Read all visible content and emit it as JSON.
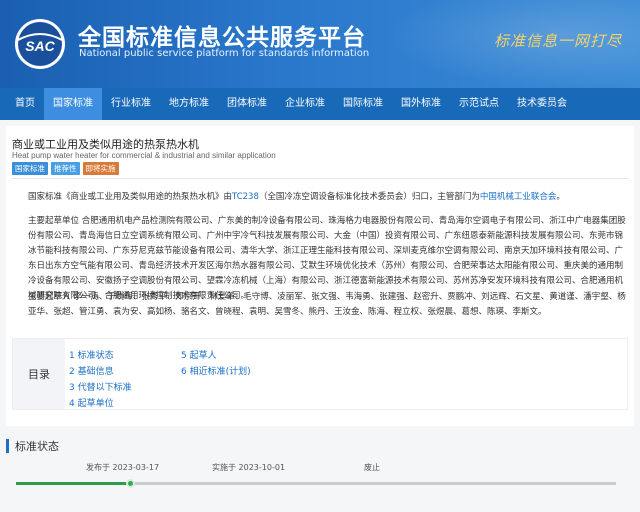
{
  "header": {
    "logo_text": "SAC",
    "title": "全国标准信息公共服务平台",
    "subtitle": "National public service platform  for standards information",
    "slogan": "标准信息一网打尽"
  },
  "nav": [
    {
      "label": "首页",
      "active": false
    },
    {
      "label": "国家标准",
      "active": true
    },
    {
      "label": "行业标准",
      "active": false
    },
    {
      "label": "地方标准",
      "active": false
    },
    {
      "label": "团体标准",
      "active": false
    },
    {
      "label": "企业标准",
      "active": false
    },
    {
      "label": "国际标准",
      "active": false
    },
    {
      "label": "国外标准",
      "active": false
    },
    {
      "label": "示范试点",
      "active": false
    },
    {
      "label": "技术委员会",
      "active": false
    }
  ],
  "standard": {
    "title": "商业或工业用及类似用途的热泵热水机",
    "title_en": "Heat pump water heater for commercial & industrial and similar application",
    "badges": [
      "国家标准",
      "推荐性",
      "即将实施"
    ],
    "org_prefix": "国家标准《商业或工业用及类似用途的热泵热水机》由",
    "tc_code": "TC238",
    "org_middle": "（全国冷冻空调设备标准化技术委员会）归口，主管部门为",
    "authority": "中国机械工业联合会",
    "org_suffix": "。",
    "drafting_units_label": "主要起草单位",
    "drafting_units": "合肥通用机电产品检测院有限公司、广东美的制冷设备有限公司、珠海格力电器股份有限公司、青岛海尔空调电子有限公司、浙江中广电器集团股份有限公司、青岛海信日立空调系统有限公司、广州中宇冷气科技发展有限公司、大金（中国）投资有限公司、广东纽恩泰新能源科技发展有限公司、东莞市锦冰节能科技有限公司、广东芬尼克兹节能设备有限公司、清华大学、浙江正理生能科技有限公司、深圳麦克维尔空调有限公司、南京天加环境科技有限公司、广东日出东方空气能有限公司、青岛经济技术开发区海尔热水器有限公司、艾默生环境优化技术（苏州）有限公司、合肥荣事达太阳能有限公司、重庆美的通用制冷设备有限公司、安徽扬子空调股份有限公司、望霖冷冻机械（上海）有限公司、浙江德富新能源技术有限公司、苏州苏净安发环境科技有限公司、合肥通用机械研究院有限公司、合肥通用环境控制技术有限责任公司。",
    "drafters_label": "主要起草人",
    "drafters": "李一涛、于晓晖、张秀平、郑宗开、林爱革、毛守博、凌丽军、张文强、韦海勇、张建强、赵密升、贾鹏冲、刘远辉、石文星、黄道谨、潘宇壑、杨亚华、张超、管江勇、袁为安、高如杨、骆名文、曾晓程、袁明、吴雪冬、熊丹、王汝金、陈海、程立权、张煜晨、葛想、陈瑛、李斯文。"
  },
  "toc": {
    "label": "目录",
    "col1": [
      "1  标准状态",
      "2  基础信息",
      "3  代替以下标准",
      "4  起草单位"
    ],
    "col2": [
      "5  起草人",
      "6  相近标准(计划)"
    ]
  },
  "status": {
    "title": "标准状态",
    "published": "发布于 2023-03-17",
    "implement": "实施于 2023-10-01",
    "abolished": "废止",
    "progress_fraction": 0.19,
    "colors": {
      "done": "#2e9b4a",
      "pending": "#c9ccd1",
      "dot_done": "#35a853"
    }
  }
}
